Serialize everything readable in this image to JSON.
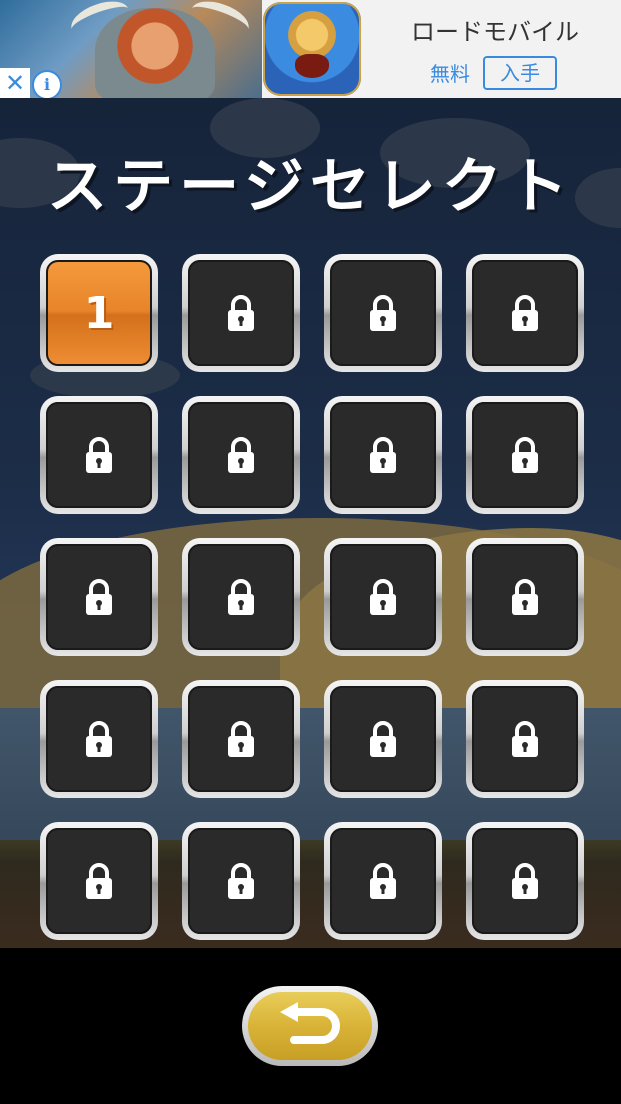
{
  "ad": {
    "title": "ロードモバイル",
    "free_label": "無料",
    "install_label": "入手",
    "close_glyph": "✕",
    "info_glyph": "i",
    "accent": "#3a8be0"
  },
  "screen": {
    "title": "ステージセレクト"
  },
  "stages": [
    {
      "label": "1",
      "locked": false
    },
    {
      "label": "",
      "locked": true
    },
    {
      "label": "",
      "locked": true
    },
    {
      "label": "",
      "locked": true
    },
    {
      "label": "",
      "locked": true
    },
    {
      "label": "",
      "locked": true
    },
    {
      "label": "",
      "locked": true
    },
    {
      "label": "",
      "locked": true
    },
    {
      "label": "",
      "locked": true
    },
    {
      "label": "",
      "locked": true
    },
    {
      "label": "",
      "locked": true
    },
    {
      "label": "",
      "locked": true
    },
    {
      "label": "",
      "locked": true
    },
    {
      "label": "",
      "locked": true
    },
    {
      "label": "",
      "locked": true
    },
    {
      "label": "",
      "locked": true
    },
    {
      "label": "",
      "locked": true
    },
    {
      "label": "",
      "locked": true
    },
    {
      "label": "",
      "locked": true
    },
    {
      "label": "",
      "locked": true
    }
  ],
  "icons": {
    "locked": "lock-icon",
    "back": "return-arrow-icon"
  },
  "colors": {
    "unlocked_tile": "#e8842a",
    "locked_tile": "#2a2a2a",
    "back_button": "#d9b337"
  }
}
